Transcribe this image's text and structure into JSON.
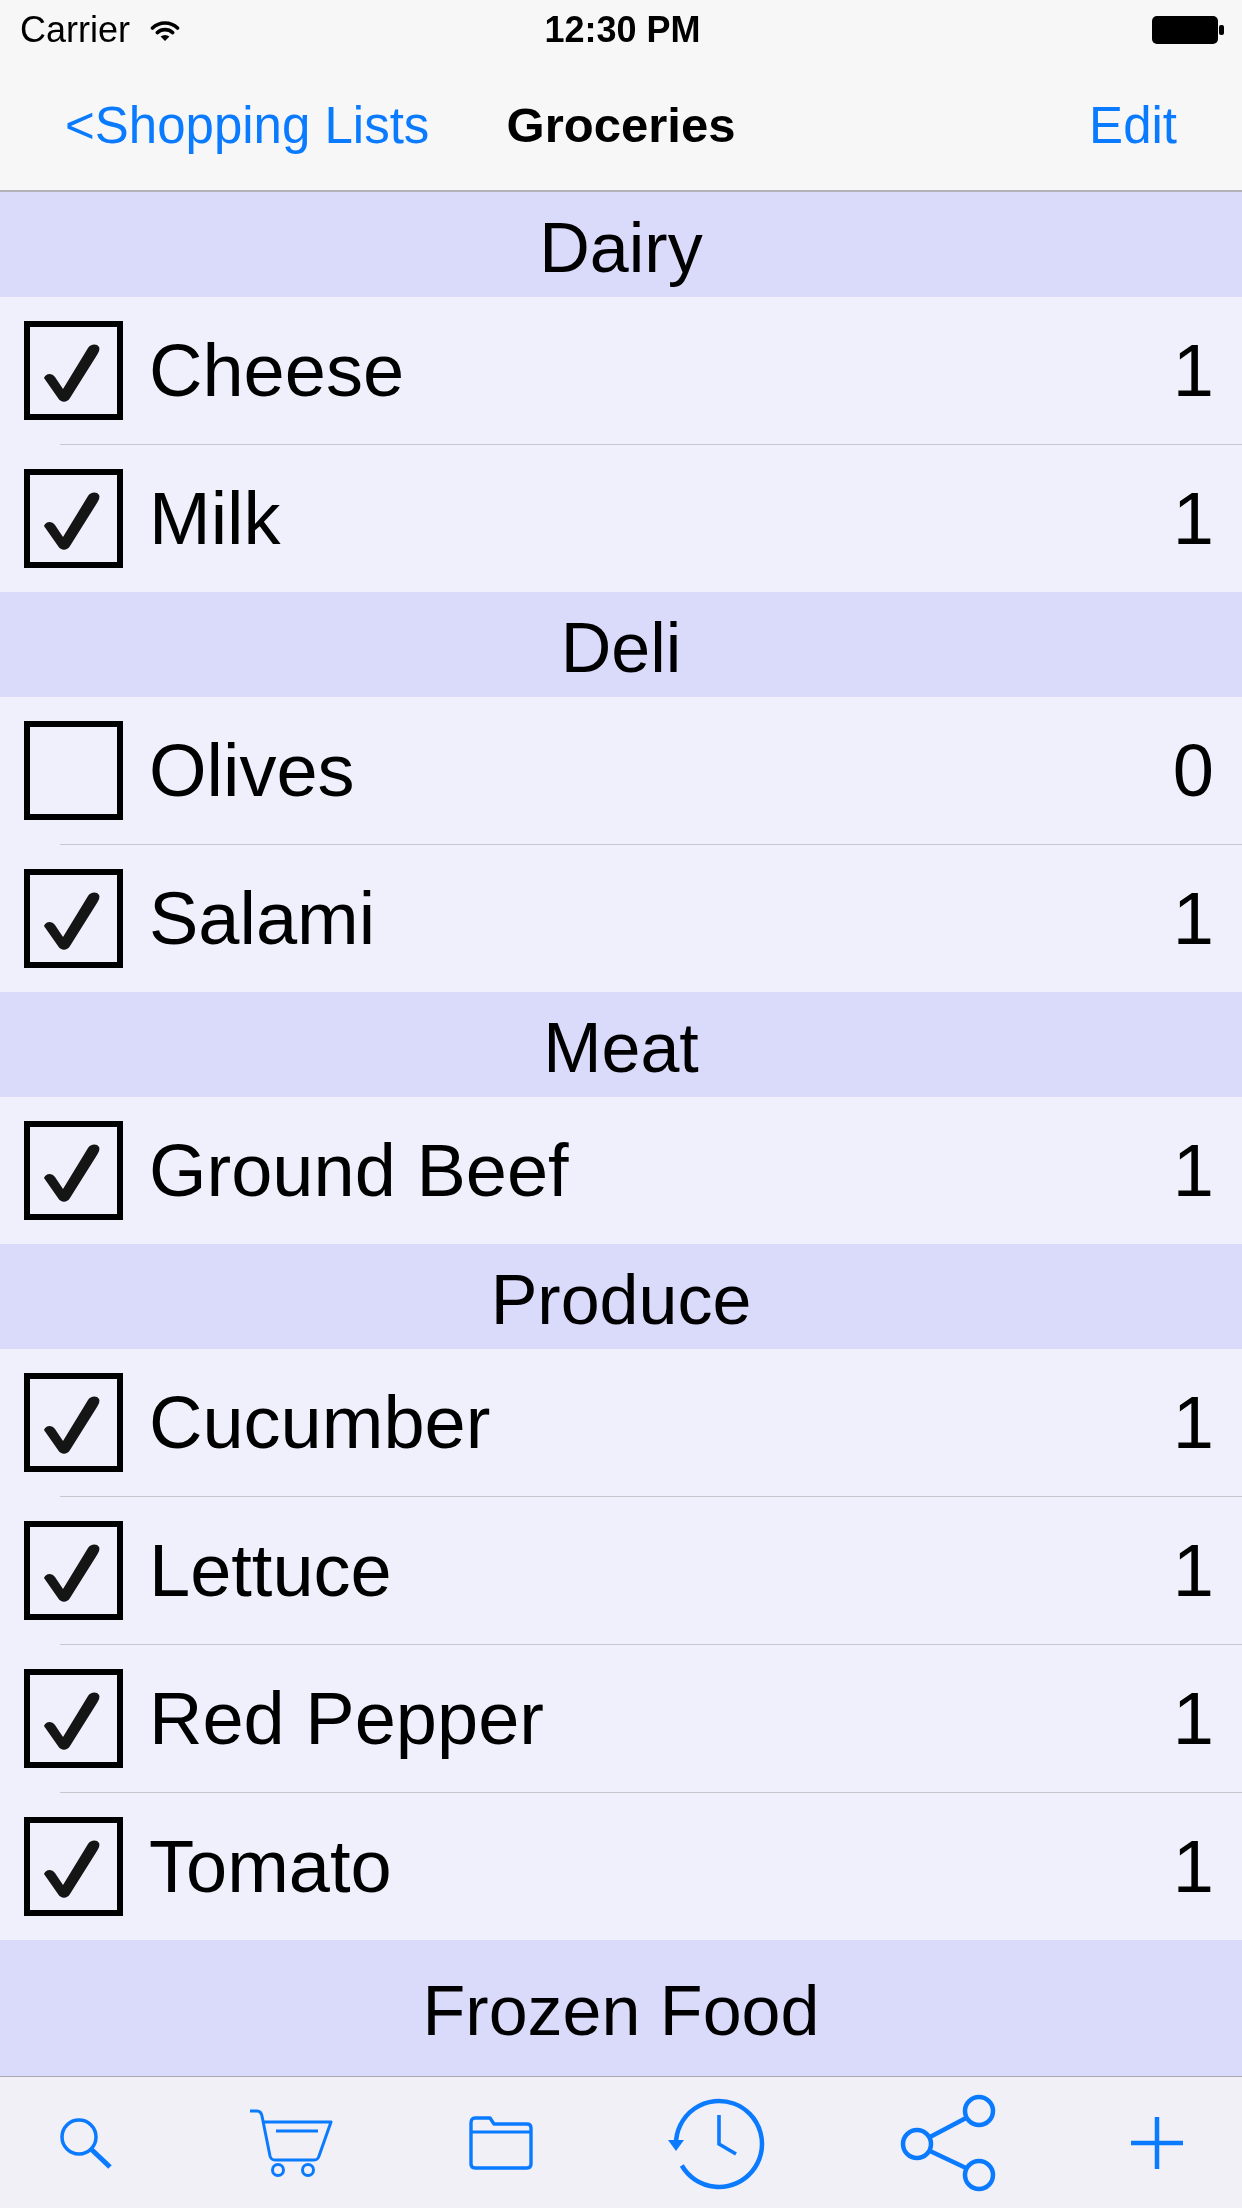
{
  "status_bar": {
    "carrier": "Carrier",
    "time": "12:30 PM"
  },
  "nav_bar": {
    "back": "<Shopping Lists",
    "title": "Groceries",
    "action": "Edit"
  },
  "sections": [
    {
      "title": "Dairy",
      "items": [
        {
          "name": "Cheese",
          "checked": true,
          "quantity": "1"
        },
        {
          "name": "Milk",
          "checked": true,
          "quantity": "1"
        }
      ]
    },
    {
      "title": "Deli",
      "items": [
        {
          "name": "Olives",
          "checked": false,
          "quantity": "0"
        },
        {
          "name": "Salami",
          "checked": true,
          "quantity": "1"
        }
      ]
    },
    {
      "title": "Meat",
      "items": [
        {
          "name": "Ground Beef",
          "checked": true,
          "quantity": "1"
        }
      ]
    },
    {
      "title": "Produce",
      "items": [
        {
          "name": "Cucumber",
          "checked": true,
          "quantity": "1"
        },
        {
          "name": "Lettuce",
          "checked": true,
          "quantity": "1"
        },
        {
          "name": "Red Pepper",
          "checked": true,
          "quantity": "1"
        },
        {
          "name": "Tomato",
          "checked": true,
          "quantity": "1"
        }
      ]
    },
    {
      "title": "Frozen Food"
    }
  ]
}
